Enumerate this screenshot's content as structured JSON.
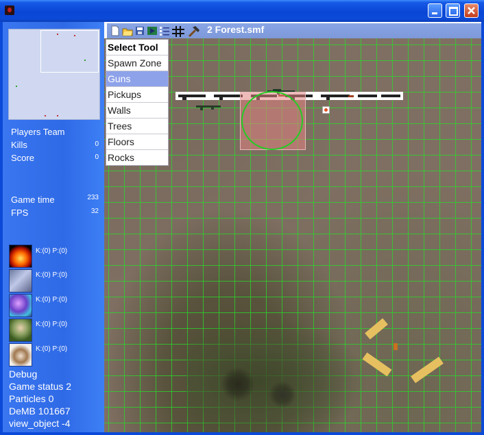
{
  "window": {
    "buttons": {
      "minimize": "minimize-button",
      "maximize": "maximize-button",
      "close": "close-button"
    }
  },
  "toolbar": {
    "map_title": "2 Forest.smf",
    "icons": [
      "new-icon",
      "open-icon",
      "save-icon",
      "play-icon",
      "list-icon",
      "grid-icon",
      "hammer-icon"
    ]
  },
  "tool_menu": {
    "header": "Select Tool",
    "items": [
      "Spawn Zone",
      "Guns",
      "Pickups",
      "Walls",
      "Trees",
      "Floors",
      "Rocks"
    ],
    "selected": "Guns"
  },
  "team": {
    "title": "Players Team",
    "kills_label": "Kills",
    "kills_value": "0",
    "score_label": "Score",
    "score_value": "0"
  },
  "stats": {
    "game_time_label": "Game time",
    "game_time_value": "233",
    "fps_label": "FPS",
    "fps_value": "32"
  },
  "players": [
    {
      "avatar": "fire-avatar",
      "stats": "K:(0) P:(0)"
    },
    {
      "avatar": "lightning-avatar",
      "stats": "K:(0) P:(0)"
    },
    {
      "avatar": "magic-avatar",
      "stats": "K:(0) P:(0)"
    },
    {
      "avatar": "soldier-avatar",
      "stats": "K:(0) P:(0)"
    },
    {
      "avatar": "hands-avatar",
      "stats": "K:(0) P:(0)"
    }
  ],
  "debug": {
    "title": "Debug",
    "game_status": "Game status 2",
    "particles": "Particles 0",
    "demb": "DeMB 101667",
    "view_object": "view_object -4"
  },
  "colors": {
    "grid": "#28dc28",
    "sidebar": "#3a76f0",
    "menu_highlight": "#8ea2ea",
    "spawn_zone": "#e18282"
  }
}
